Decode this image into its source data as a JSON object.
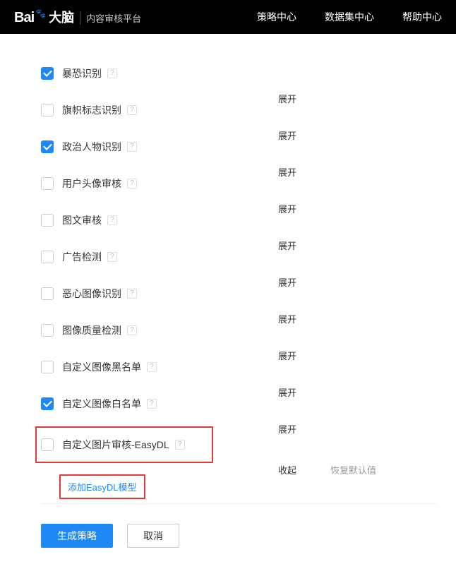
{
  "header": {
    "logo_main": "Bai",
    "logo_suffix": "大脑",
    "subtitle": "内容审核平台",
    "nav": [
      "策略中心",
      "数据集中心",
      "帮助中心"
    ]
  },
  "items": [
    {
      "label": "暴恐识别",
      "checked": true,
      "action": "展开"
    },
    {
      "label": "旗帜标志识别",
      "checked": false,
      "action": "展开"
    },
    {
      "label": "政治人物识别",
      "checked": true,
      "action": "展开"
    },
    {
      "label": "用户头像审核",
      "checked": false,
      "action": "展开"
    },
    {
      "label": "图文审核",
      "checked": false,
      "action": "展开"
    },
    {
      "label": "广告检测",
      "checked": false,
      "action": "展开"
    },
    {
      "label": "恶心图像识别",
      "checked": false,
      "action": "展开"
    },
    {
      "label": "图像质量检测",
      "checked": false,
      "action": "展开"
    },
    {
      "label": "自定义图像黑名单",
      "checked": false,
      "action": "展开"
    },
    {
      "label": "自定义图像白名单",
      "checked": true,
      "action": "展开"
    }
  ],
  "easydl": {
    "label": "自定义图片审核-EasyDL",
    "checked": false,
    "action": "收起",
    "restore": "恢复默认值",
    "add": "添加EasyDL模型"
  },
  "buttons": {
    "submit": "生成策略",
    "cancel": "取消"
  }
}
